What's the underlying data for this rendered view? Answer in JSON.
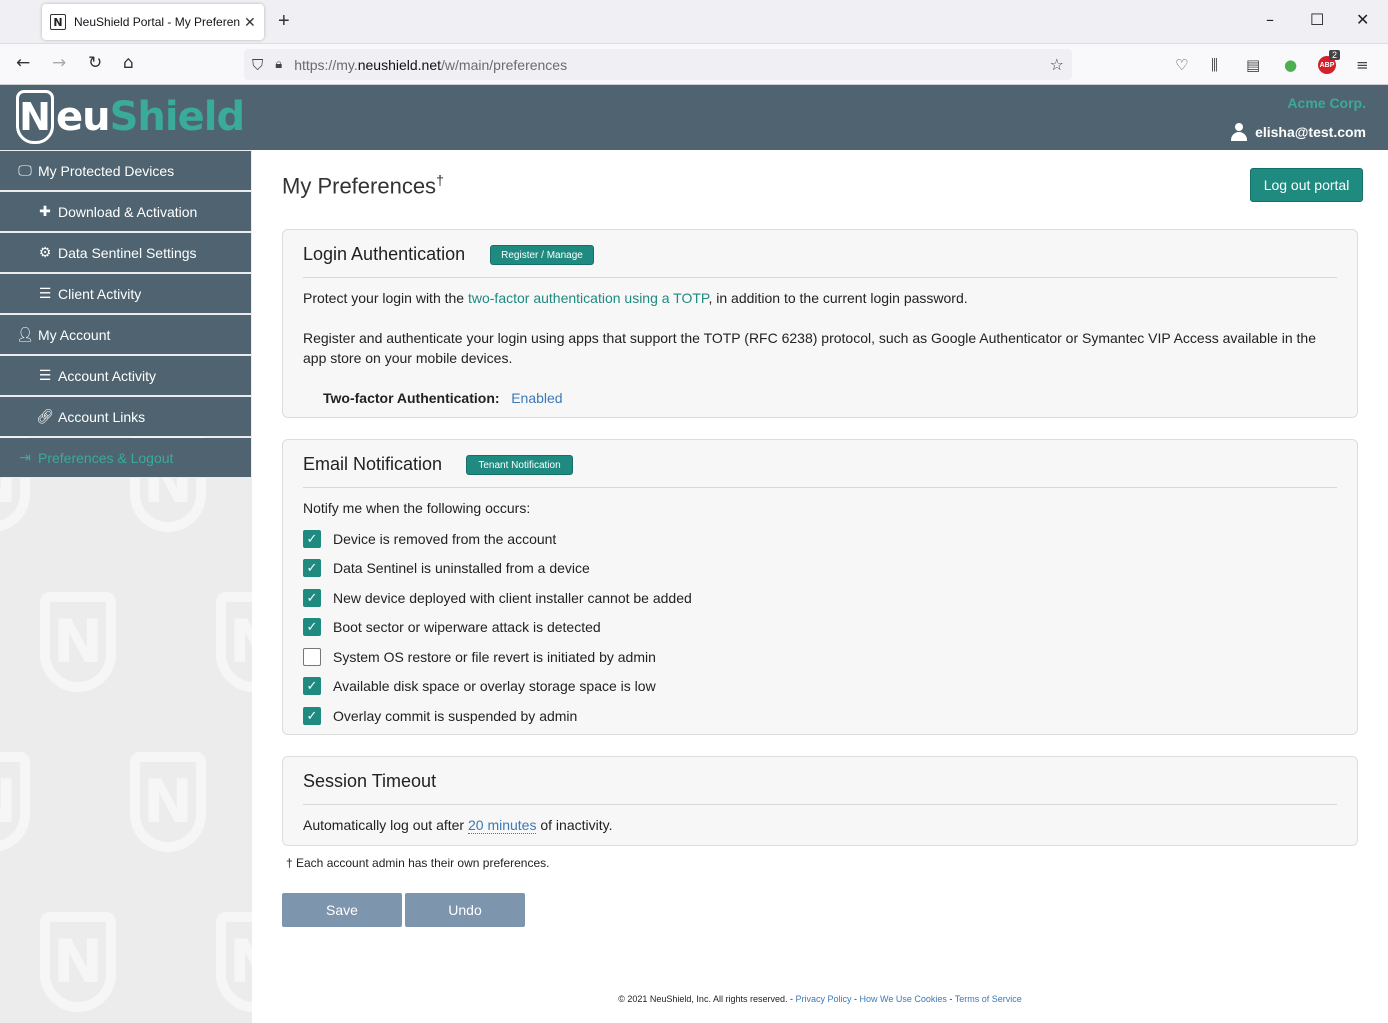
{
  "browser": {
    "tab_title": "NeuShield Portal - My Preferences",
    "tab_favicon": "N",
    "url_prefix": "https://my.",
    "url_domain": "neushield.net",
    "url_path": "/w/main/preferences",
    "abp_label": "ABP",
    "abp_badge": "2"
  },
  "header": {
    "logo_n": "N",
    "logo_eu": "eu",
    "logo_shield": "Shield",
    "company": "Acme Corp.",
    "user_email": "elisha@test.com"
  },
  "sidebar": {
    "items": [
      {
        "label": "My Protected Devices",
        "icon": "monitor-icon"
      },
      {
        "label": "Download & Activation",
        "icon": "plus-icon"
      },
      {
        "label": "Data Sentinel Settings",
        "icon": "gears-icon"
      },
      {
        "label": "Client Activity",
        "icon": "list-icon"
      },
      {
        "label": "My Account",
        "icon": "user-icon"
      },
      {
        "label": "Account Activity",
        "icon": "list-icon"
      },
      {
        "label": "Account Links",
        "icon": "link-icon"
      },
      {
        "label": "Preferences & Logout",
        "icon": "sign-out-icon"
      }
    ]
  },
  "page": {
    "title": "My Preferences",
    "title_mark": "†",
    "logout_label": "Log out portal"
  },
  "login_auth": {
    "heading": "Login Authentication",
    "manage_label": "Register / Manage",
    "p1_before": "Protect your login with the ",
    "p1_link": "two-factor authentication using a TOTP",
    "p1_after": ", in addition to the current login password.",
    "p2": "Register and authenticate your login using apps that support the TOTP (RFC 6238) protocol, such as Google Authenticator or Symantec VIP Access available in the app store on your mobile devices.",
    "status_label": "Two-factor Authentication:",
    "status_value": "Enabled"
  },
  "email_notification": {
    "heading": "Email Notification",
    "tenant_label": "Tenant Notification",
    "intro": "Notify me when the following occurs:",
    "options": [
      {
        "label": "Device is removed from the account",
        "checked": true
      },
      {
        "label": "Data Sentinel is uninstalled from a device",
        "checked": true
      },
      {
        "label": "New device deployed with client installer cannot be added",
        "checked": true
      },
      {
        "label": "Boot sector or wiperware attack is detected",
        "checked": true
      },
      {
        "label": "System OS restore or file revert is initiated by admin",
        "checked": false
      },
      {
        "label": "Available disk space or overlay storage space is low",
        "checked": true
      },
      {
        "label": "Overlay commit is suspended by admin",
        "checked": true
      }
    ]
  },
  "session_timeout": {
    "heading": "Session Timeout",
    "text_before": "Automatically log out after ",
    "timeout_link": "20 minutes",
    "text_after": " of inactivity."
  },
  "footnote": "† Each account admin has their own preferences.",
  "actions": {
    "save_label": "Save",
    "undo_label": "Undo"
  },
  "footer": {
    "copyright": "© 2021 NeuShield, Inc. All rights reserved. - ",
    "privacy": "Privacy Policy",
    "sep1": " - ",
    "cookies": "How We Use Cookies",
    "sep2": " - ",
    "terms": "Terms of Service"
  }
}
